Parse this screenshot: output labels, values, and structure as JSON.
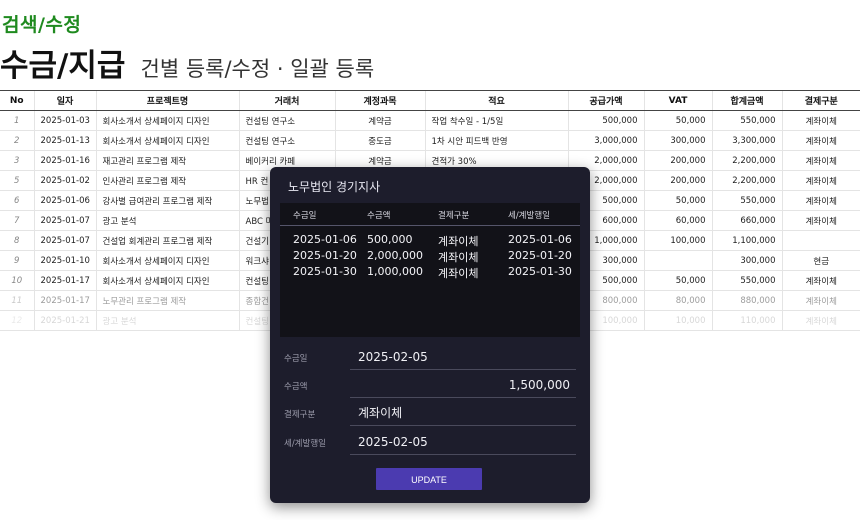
{
  "breadcrumb": "검색/수정",
  "page": {
    "title": "수금/지급",
    "subtitle": "건별 등록/수정 · 일괄 등록"
  },
  "table": {
    "columns": [
      "No",
      "일자",
      "프로젝트명",
      "거래처",
      "계정과목",
      "적요",
      "공급가액",
      "VAT",
      "합계금액",
      "결제구분"
    ],
    "rows": [
      {
        "no": "1",
        "date": "2025-01-03",
        "project": "회사소개서 상세페이지 디자인",
        "client": "컨설팅 연구소",
        "account": "계약금",
        "memo": "작업 착수일 - 1/5일",
        "supply": "500,000",
        "vat": "50,000",
        "total": "550,000",
        "payment": "계좌이체"
      },
      {
        "no": "2",
        "date": "2025-01-13",
        "project": "회사소개서 상세페이지 디자인",
        "client": "컨설팅 연구소",
        "account": "중도금",
        "memo": "1차 시안 피드백 반영",
        "supply": "3,000,000",
        "vat": "300,000",
        "total": "3,300,000",
        "payment": "계좌이체"
      },
      {
        "no": "3",
        "date": "2025-01-16",
        "project": "재고관리 프로그램 제작",
        "client": "베이커리 카페",
        "account": "계약금",
        "memo": "견적가 30%",
        "supply": "2,000,000",
        "vat": "200,000",
        "total": "2,200,000",
        "payment": "계좌이체"
      },
      {
        "no": "5",
        "date": "2025-01-02",
        "project": "인사관리 프로그램 제작",
        "client": "HR 컨",
        "account": "",
        "memo": "",
        "supply": "2,000,000",
        "vat": "200,000",
        "total": "2,200,000",
        "payment": "계좌이체"
      },
      {
        "no": "6",
        "date": "2025-01-06",
        "project": "강사별 급여관리 프로그램 제작",
        "client": "노무법",
        "account": "",
        "memo": "",
        "supply": "500,000",
        "vat": "50,000",
        "total": "550,000",
        "payment": "계좌이체"
      },
      {
        "no": "7",
        "date": "2025-01-07",
        "project": "광고 분석",
        "client": "ABC 마",
        "account": "",
        "memo": "",
        "supply": "600,000",
        "vat": "60,000",
        "total": "660,000",
        "payment": "계좌이체"
      },
      {
        "no": "8",
        "date": "2025-01-07",
        "project": "건설업 회계관리 프로그램 제작",
        "client": "건설기",
        "account": "",
        "memo": "",
        "supply": "1,000,000",
        "vat": "100,000",
        "total": "1,100,000",
        "payment": ""
      },
      {
        "no": "9",
        "date": "2025-01-10",
        "project": "회사소개서 상세페이지 디자인",
        "client": "워크샤",
        "account": "",
        "memo": "",
        "supply": "300,000",
        "vat": "",
        "total": "300,000",
        "payment": "현금"
      },
      {
        "no": "10",
        "date": "2025-01-17",
        "project": "회사소개서 상세페이지 디자인",
        "client": "컨설팅",
        "account": "",
        "memo": "",
        "supply": "500,000",
        "vat": "50,000",
        "total": "550,000",
        "payment": "계좌이체"
      },
      {
        "no": "11",
        "date": "2025-01-17",
        "project": "노무관리 프로그램 제작",
        "client": "종합건",
        "account": "",
        "memo": "",
        "supply": "800,000",
        "vat": "80,000",
        "total": "880,000",
        "payment": "계좌이체"
      },
      {
        "no": "12",
        "date": "2025-01-21",
        "project": "광고 분석",
        "client": "컨설팅",
        "account": "",
        "memo": "",
        "supply": "100,000",
        "vat": "10,000",
        "total": "110,000",
        "payment": "계좌이체"
      }
    ]
  },
  "modal": {
    "title": "노무법인 경기지사",
    "history_headers": [
      "수금일",
      "수금액",
      "결제구분",
      "세/계발행일"
    ],
    "history_rows": [
      {
        "date": "2025-01-06",
        "amount": "500,000",
        "method": "계좌이체",
        "issue": "2025-01-06"
      },
      {
        "date": "2025-01-20",
        "amount": "2,000,000",
        "method": "계좌이체",
        "issue": "2025-01-20"
      },
      {
        "date": "2025-01-30",
        "amount": "1,000,000",
        "method": "계좌이체",
        "issue": "2025-01-30"
      }
    ],
    "form": {
      "date_label": "수금일",
      "date_value": "2025-02-05",
      "amount_label": "수금액",
      "amount_value": "1,500,000",
      "method_label": "결제구분",
      "method_value": "계좌이체",
      "issue_label": "세/계발행일",
      "issue_value": "2025-02-05"
    },
    "update_label": "UPDATE"
  }
}
